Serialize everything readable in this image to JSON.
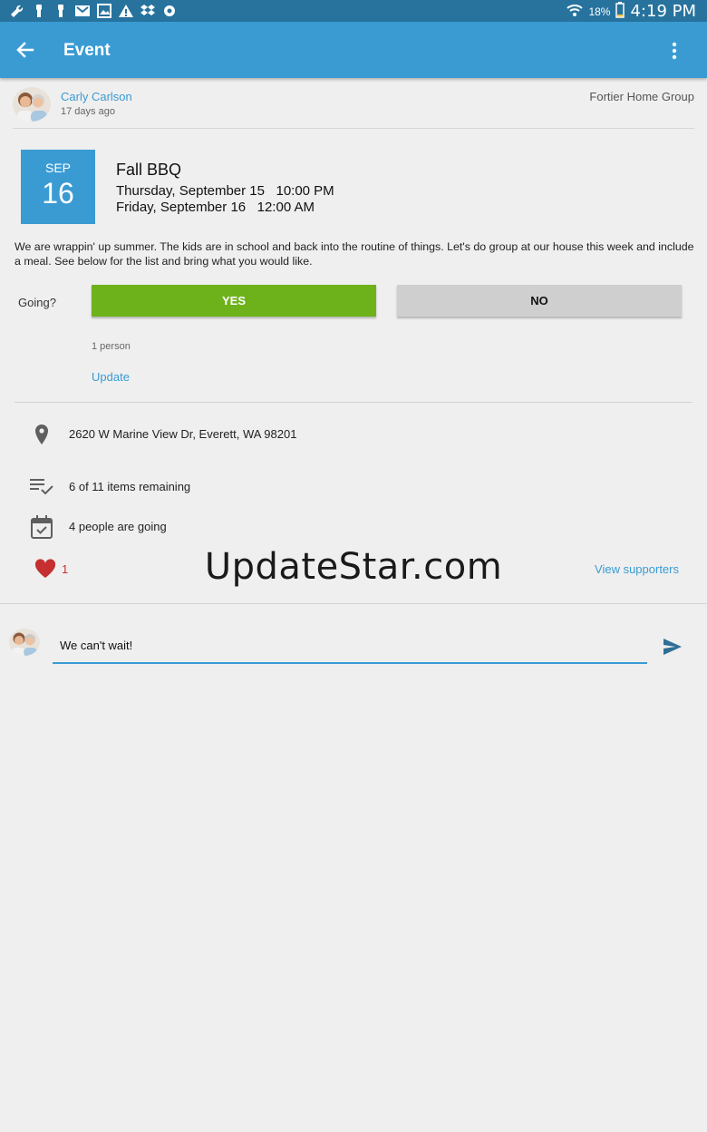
{
  "status_bar": {
    "battery": "18%",
    "time": "4:19 PM",
    "icons": [
      "wrench-icon",
      "usb-icon",
      "usb-icon",
      "gmail-icon",
      "image-icon",
      "warning-icon",
      "dropbox-icon",
      "settings-icon"
    ]
  },
  "app_bar": {
    "title": "Event"
  },
  "author": {
    "name": "Carly Carlson",
    "ago": "17 days ago",
    "group": "Fortier Home Group"
  },
  "event": {
    "month": "SEP",
    "day": "16",
    "title": "Fall BBQ",
    "start": "Thursday, September 15   10:00 PM",
    "end": "Friday, September 16   12:00 AM",
    "description": "We are wrappin' up summer. The kids are in school and back into the routine of things. Let's do group at our house this week and include a meal. See below for the list and bring what you would like."
  },
  "rsvp": {
    "question": "Going?",
    "yes_label": "YES",
    "no_label": "NO",
    "count": "1 person",
    "update_label": "Update"
  },
  "details": {
    "address": "2620 W Marine View Dr, Everett, WA  98201",
    "items": "6 of 11 items remaining",
    "going": "4 people are going"
  },
  "likes": {
    "count": "1",
    "view_supporters": "View supporters"
  },
  "watermark": "UpdateStar.com",
  "comment": {
    "value": "We can't wait!"
  },
  "colors": {
    "primary": "#3a9bd3",
    "status_bar": "#27739e",
    "yes": "#6db21a",
    "no": "#cfcfcf",
    "heart": "#c62f2f"
  }
}
